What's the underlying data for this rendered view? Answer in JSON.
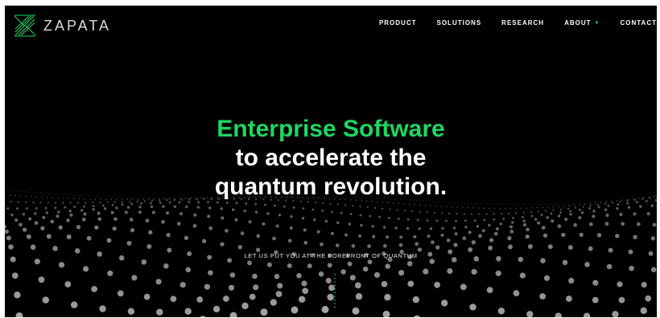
{
  "brand": {
    "name": "ZAPATA",
    "accent": "#1ed760"
  },
  "nav": {
    "items": [
      {
        "label": "PRODUCT"
      },
      {
        "label": "SOLUTIONS"
      },
      {
        "label": "RESEARCH"
      },
      {
        "label": "ABOUT",
        "icon": "chevron-down-icon"
      },
      {
        "label": "CONTACT"
      }
    ]
  },
  "hero": {
    "line1": "Enterprise Software",
    "line2": "to accelerate the",
    "line3": "quantum revolution.",
    "tagline": "LET US PUT YOU AT THE FOREFRONT OF QUANTUM"
  },
  "colors": {
    "background": "#000000",
    "text": "#ffffff",
    "dots": "#b5b5b5"
  }
}
